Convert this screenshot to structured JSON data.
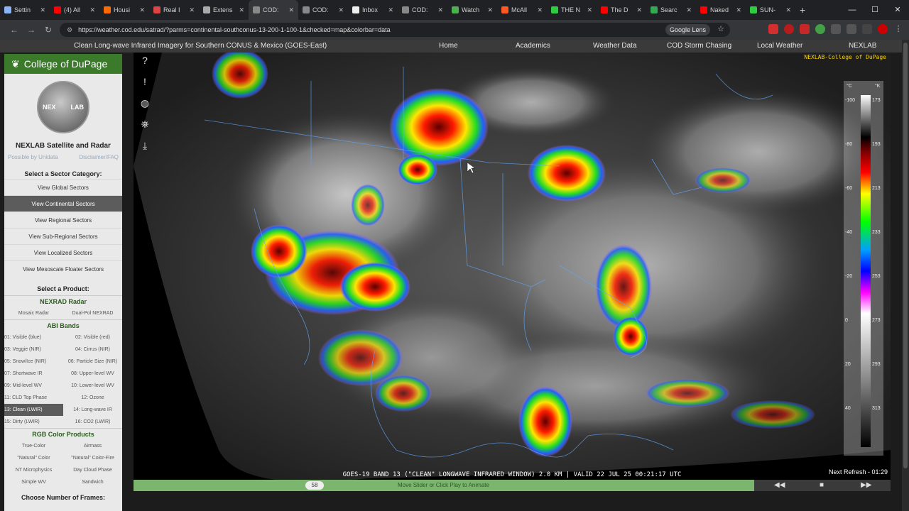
{
  "browser": {
    "tabs": [
      {
        "label": "Settin",
        "color": "#8ab4f8"
      },
      {
        "label": "(4) All",
        "color": "#ff0000"
      },
      {
        "label": "Housi",
        "color": "#ff6a00"
      },
      {
        "label": "Real I",
        "color": "#d44"
      },
      {
        "label": "Extens",
        "color": "#aaa"
      },
      {
        "label": "COD:",
        "color": "#888",
        "active": true
      },
      {
        "label": "COD:",
        "color": "#888"
      },
      {
        "label": "Inbox",
        "color": "#eee"
      },
      {
        "label": "COD:",
        "color": "#888"
      },
      {
        "label": "Watch",
        "color": "#4caf50"
      },
      {
        "label": "McAll",
        "color": "#ff5722"
      },
      {
        "label": "THE N",
        "color": "#2ecc40"
      },
      {
        "label": "The D",
        "color": "#ff0000"
      },
      {
        "label": "Searc",
        "color": "#34a853"
      },
      {
        "label": "Naked",
        "color": "#ff0000"
      },
      {
        "label": "SUN-",
        "color": "#2ecc40"
      }
    ],
    "new_tab": "+",
    "url": "https://weather.cod.edu/satrad/?parms=continental-southconus-13-200-1-100-1&checked=map&colorbar=data",
    "lens_label": "Google Lens"
  },
  "nav": {
    "page_title": "Clean Long-wave Infrared Imagery for Southern CONUS & Mexico (GOES-East)",
    "links": [
      "Home",
      "Academics",
      "Weather Data",
      "COD Storm Chasing",
      "Local Weather",
      "NEXLAB"
    ]
  },
  "sidebar": {
    "brand": "College of DuPage",
    "logo_left": "NEX",
    "logo_right": "LAB",
    "title": "NEXLAB Satellite and Radar",
    "possible_by": "Possible by Unidata",
    "disclaimer": "Disclaimer/FAQ",
    "sector_label": "Select a Sector Category:",
    "sectors": [
      {
        "label": "View Global Sectors",
        "active": false
      },
      {
        "label": "View Continental Sectors",
        "active": true
      },
      {
        "label": "View Regional Sectors",
        "active": false
      },
      {
        "label": "View Sub-Regional Sectors",
        "active": false
      },
      {
        "label": "View Localized Sectors",
        "active": false
      },
      {
        "label": "View Mesoscale Floater Sectors",
        "active": false
      }
    ],
    "product_label": "Select a Product:",
    "nexrad_head": "NEXRAD Radar",
    "nexrad_items": [
      "Mosaic Radar",
      "Dual-Pol NEXRAD"
    ],
    "abi_head": "ABI Bands",
    "abi_rows": [
      [
        "01: Visible (blue)",
        "02: Visible (red)"
      ],
      [
        "03: Veggie (NIR)",
        "04: Cirrus (NIR)"
      ],
      [
        "05: Snow/Ice (NIR)",
        "06: Particle Size (NIR)"
      ],
      [
        "07: Shortwave IR",
        "08: Upper-level WV"
      ],
      [
        "09: Mid-level WV",
        "10: Lower-level WV"
      ],
      [
        "11: CLD Top Phase",
        "12: Ozone"
      ],
      [
        "13: Clean (LWIR)",
        "14: Long-wave IR"
      ],
      [
        "15: Dirty (LWIR)",
        "16: CO2 (LWIR)"
      ]
    ],
    "rgb_head": "RGB Color Products",
    "rgb_rows": [
      [
        "True-Color",
        "Airmass"
      ],
      [
        "\"Natural\" Color",
        "\"Natural\" Color-Fire"
      ],
      [
        "NT Microphysics",
        "Day Cloud Phase"
      ],
      [
        "Simple WV",
        "Sandwich"
      ]
    ],
    "frames_label": "Choose Number of Frames:"
  },
  "tools": {
    "help_icon": "?",
    "alert_icon": "!",
    "globe_icon": "◍",
    "satellite_icon": "⛯",
    "download_icon": "⤓"
  },
  "image": {
    "watermark": "NEXLAB-College of DuPage",
    "caption": "GOES-19 BAND 13 (\"CLEAN\" LONGWAVE INFRARED WINDOW) 2.0 KM | VALID 22 JUL 25 00:21:17 UTC",
    "refresh": "Next Refresh - 01:29",
    "colorbar_units": [
      "°C",
      "°K"
    ],
    "colorbar_ticks_c": [
      "-100",
      "-80",
      "-60",
      "-40",
      "-20",
      "0",
      "20",
      "40"
    ],
    "colorbar_ticks_k": [
      "173",
      "193",
      "213",
      "233",
      "253",
      "273",
      "293",
      "313"
    ]
  },
  "slider": {
    "value": "58",
    "hint": "Move Slider or Click Play to Animate",
    "rewind": "◀◀",
    "play": "■",
    "forward": "▶▶"
  }
}
